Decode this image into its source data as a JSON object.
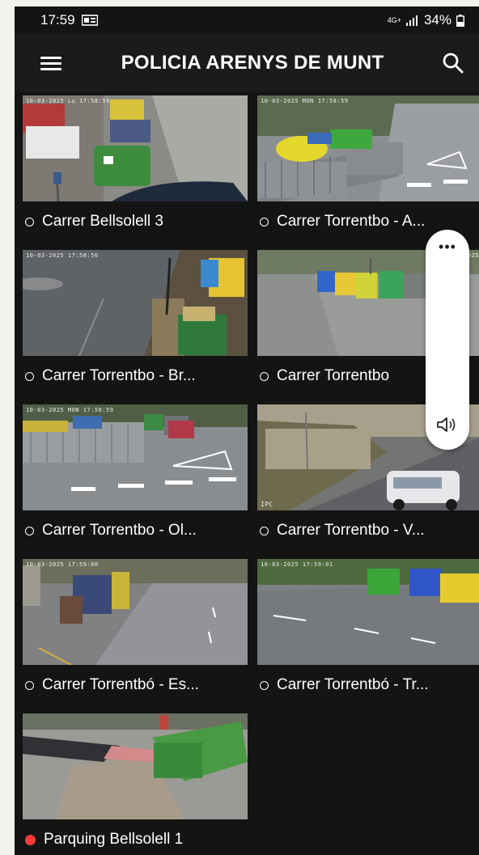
{
  "status_bar": {
    "time": "17:59",
    "network": "4G+",
    "battery": "34%"
  },
  "app_bar": {
    "title": "POLICIA ARENYS DE MUNT"
  },
  "cameras": [
    {
      "label": "Carrer Bellsolell 3",
      "live": false,
      "timestamp": "10-03-2025 Lu 17:58:59"
    },
    {
      "label": "Carrer Torrentbo - A...",
      "live": false,
      "timestamp": "10-03-2025 MON 17:58:59"
    },
    {
      "label": "Carrer Torrentbo - Br...",
      "live": false,
      "timestamp": "10-03-2025 17:58:56"
    },
    {
      "label": "Carrer Torrentbo",
      "live": false,
      "timestamp": "2025"
    },
    {
      "label": "Carrer Torrentbo - Ol...",
      "live": false,
      "timestamp": "10-03-2025 MON 17:58:59"
    },
    {
      "label": "Carrer Torrentbo - V...",
      "live": false,
      "timestamp": ""
    },
    {
      "label": "Carrer Torrentbó - Es...",
      "live": false,
      "timestamp": "10-03-2025 17:59:00"
    },
    {
      "label": "Carrer Torrentbó - Tr...",
      "live": false,
      "timestamp": "10-03-2025 17:59:01"
    },
    {
      "label": "Parquing Bellsolell 1",
      "live": true,
      "timestamp": ""
    }
  ],
  "camera_watermarks": {
    "ipc": "IPC"
  },
  "volume_panel": {
    "more_symbol": "•••",
    "speaker_icon": "speaker-icon"
  },
  "colors": {
    "live_dot": "#ff3b3b",
    "background": "#141414",
    "app_bar": "#1b1b1b"
  }
}
